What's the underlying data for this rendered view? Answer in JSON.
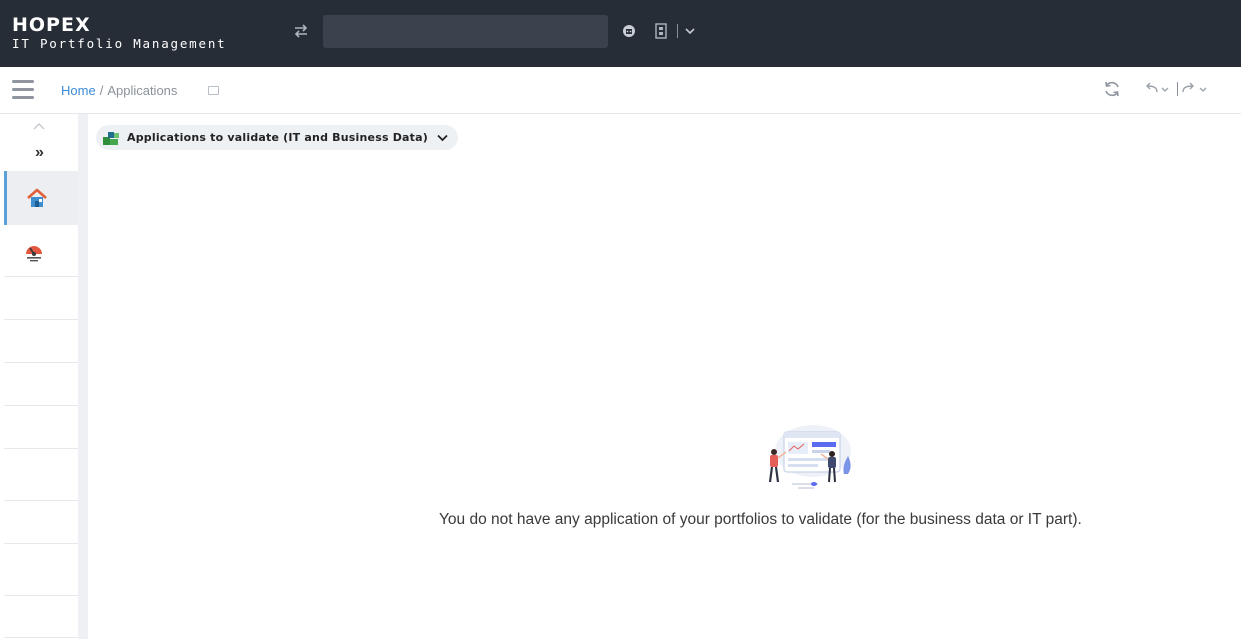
{
  "header": {
    "logo": "HOPEX",
    "product": "IT Portfolio Management",
    "search": {
      "value": "",
      "placeholder": ""
    }
  },
  "breadcrumb": {
    "home": "Home",
    "separator": "/",
    "current": "Applications"
  },
  "content": {
    "view_selector_label": "Applications to validate (IT and Business Data)",
    "empty_message": "You do not have any application of your portfolios to validate (for the business data or IT part)."
  },
  "rail": {
    "items": [
      {
        "icon": "home-icon",
        "active": true
      },
      {
        "icon": "dashboard-gauge-icon",
        "active": false
      }
    ]
  },
  "colors": {
    "header_bg": "#262d36",
    "link": "#3b8bd8",
    "active_accent": "#5aa0d8"
  }
}
